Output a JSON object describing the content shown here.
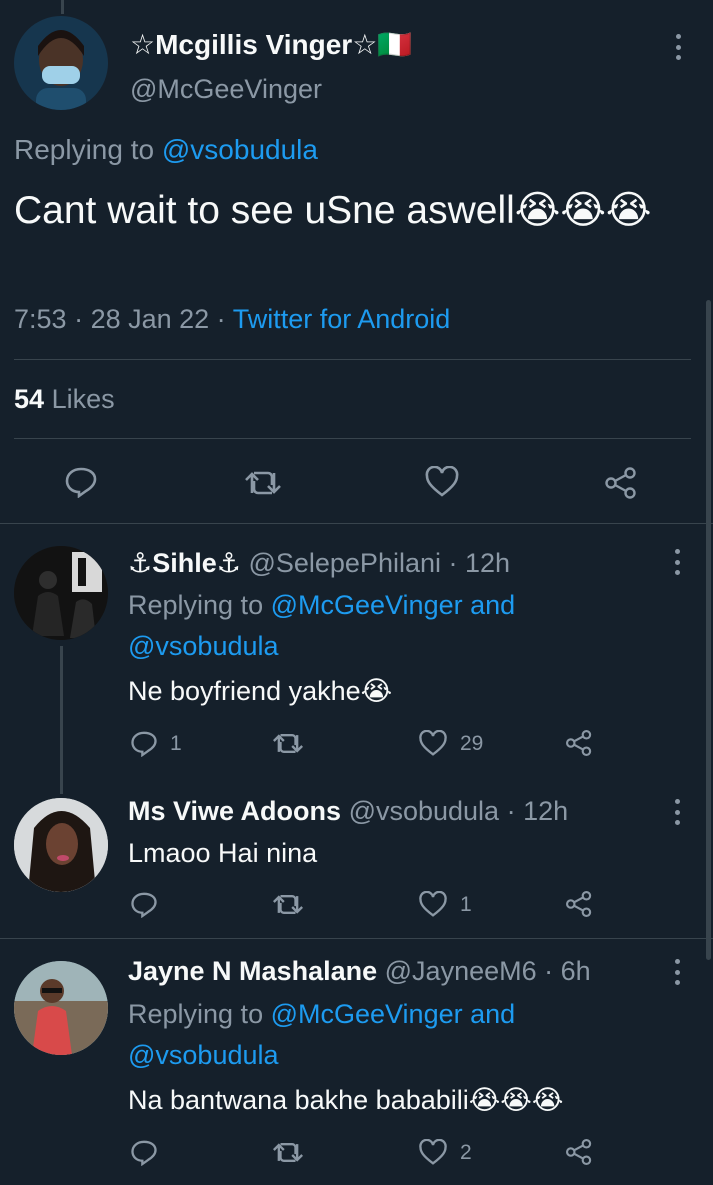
{
  "main_tweet": {
    "name": "☆Mcgillis Vinger☆",
    "flag": "🇮🇹",
    "handle": "@McGeeVinger",
    "replying_prefix": "Replying to ",
    "replying_to": "@vsobudula",
    "text": "Cant wait to see uSne aswell😭😭😭",
    "time": "7:53",
    "date": "28 Jan 22",
    "source": "Twitter for Android",
    "likes_count": "54",
    "likes_label": "Likes"
  },
  "replies": [
    {
      "name": "⚓Sihle⚓",
      "handle": "@SelepePhilani",
      "time": "12h",
      "replying_prefix": "Replying to ",
      "replying_to_line1": "@McGeeVinger and",
      "replying_to_line2": "@vsobudula",
      "text": "Ne boyfriend yakhe😭",
      "reply_count": "1",
      "retweet_count": "",
      "like_count": "29"
    },
    {
      "name": "Ms Viwe Adoons",
      "handle": "@vsobudula",
      "time": "12h",
      "text": "Lmaoo Hai nina",
      "reply_count": "",
      "retweet_count": "",
      "like_count": "1"
    },
    {
      "name": "Jayne N Mashalane",
      "handle": "@JayneeM6",
      "time": "6h",
      "replying_prefix": "Replying to ",
      "replying_to_line1": "@McGeeVinger and",
      "replying_to_line2": "@vsobudula",
      "text": "Na bantwana bakhe bababili😭😭😭",
      "reply_count": "",
      "retweet_count": "",
      "like_count": "2"
    }
  ],
  "separator": " · ",
  "icons": [
    "reply-icon",
    "retweet-icon",
    "like-icon",
    "share-icon",
    "more-icon"
  ],
  "colors": {
    "background": "#15202b",
    "text": "#f7f9f9",
    "muted": "#8b98a5",
    "link": "#1d9bf0",
    "divider": "#38444d"
  }
}
